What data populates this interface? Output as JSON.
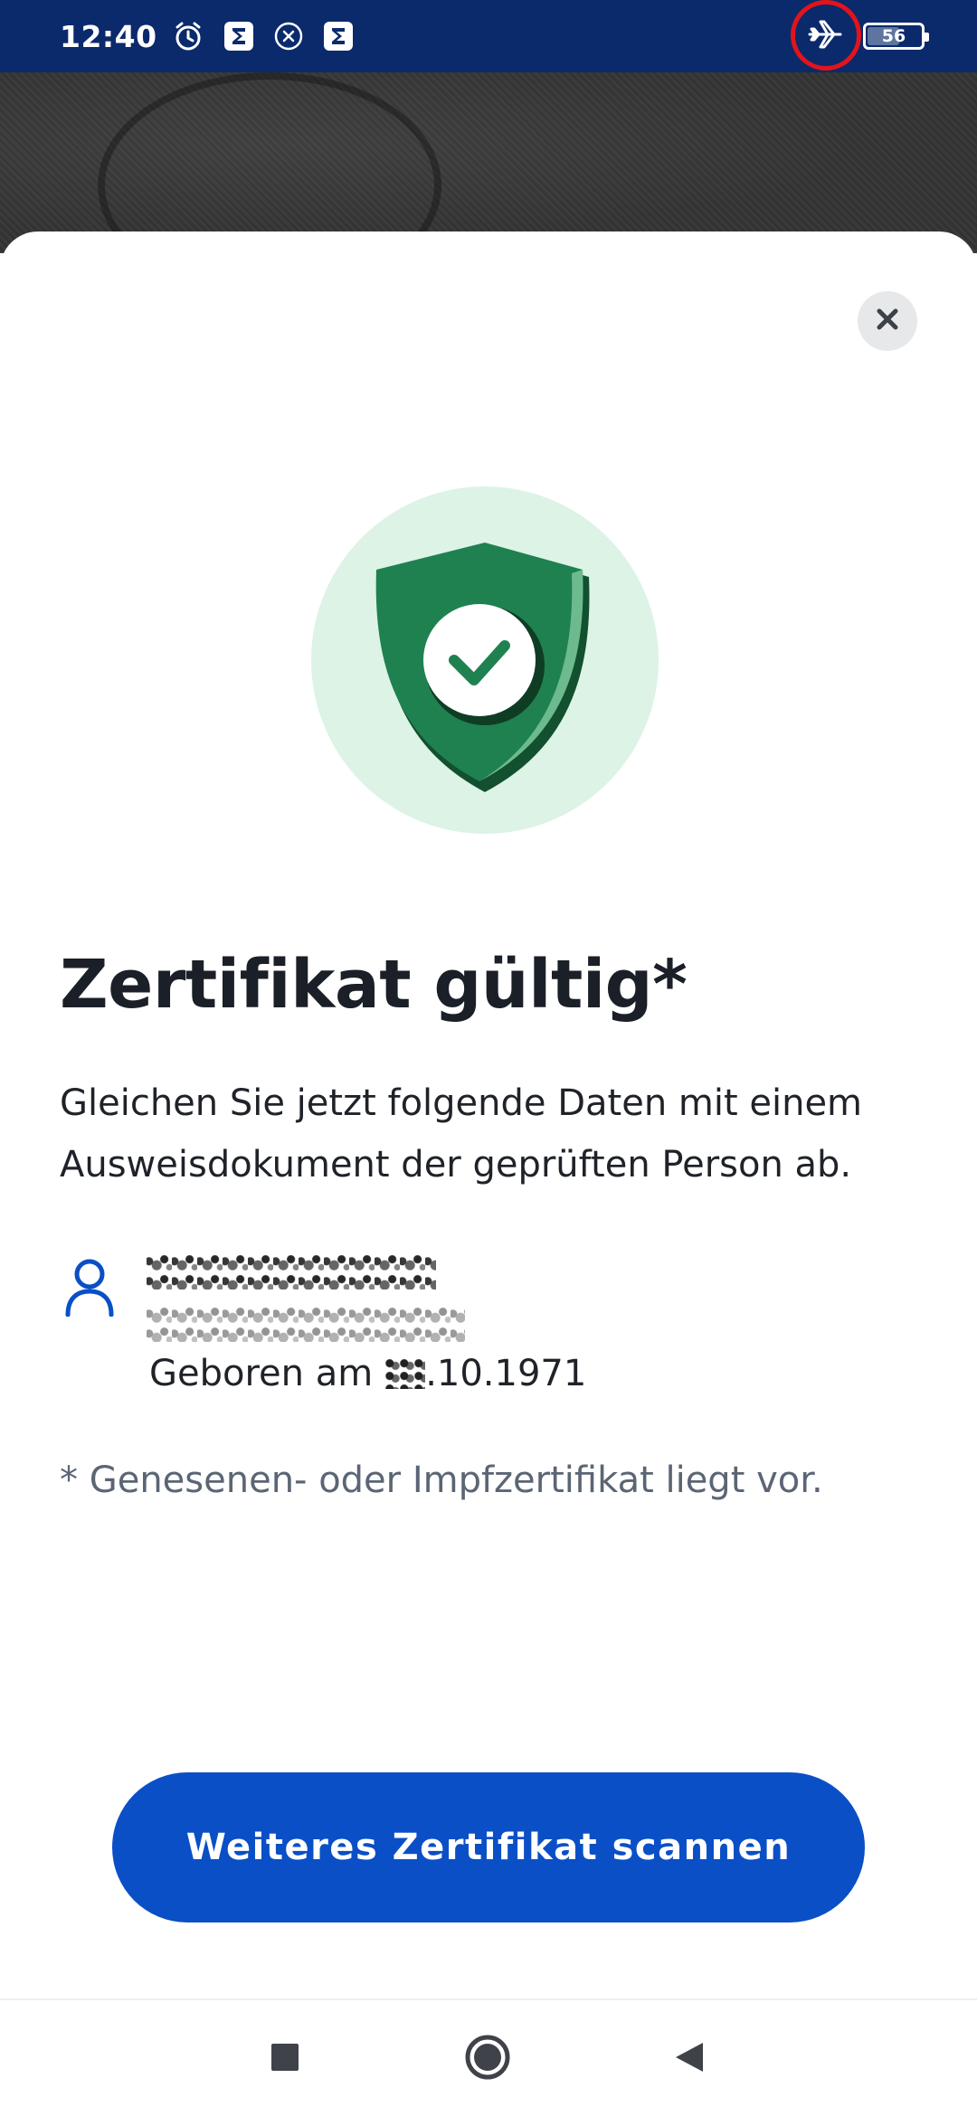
{
  "status_bar": {
    "time": "12:40",
    "battery_level": "56",
    "icons_left": [
      "alarm-icon",
      "sigma-app-icon",
      "x-notification-icon",
      "sigma-app-icon"
    ],
    "icons_right": [
      "airplane-mode-icon",
      "battery-icon"
    ],
    "highlight_color": "#e2141b"
  },
  "result": {
    "title": "Zertifikat gültig*",
    "description": "Gleichen Sie jetzt folgende Daten mit einem Ausweisdokument der geprüften Person ab.",
    "birth_label": "Geboren am",
    "birth_date_suffix": ".10.1971",
    "footnote": "* Genesenen- oder Impfzertifikat liegt vor."
  },
  "actions": {
    "scan_button_label": "Weiteres Zertifikat scannen"
  },
  "colors": {
    "status_bar": "#0a2a6b",
    "primary": "#0a4fc6",
    "shield_green": "#1f8150",
    "shield_circle": "#dcf3e5",
    "title_text": "#1b1f27",
    "footnote_text": "#5b6574"
  },
  "navigation": {
    "items": [
      "recent-apps",
      "home",
      "back"
    ]
  }
}
